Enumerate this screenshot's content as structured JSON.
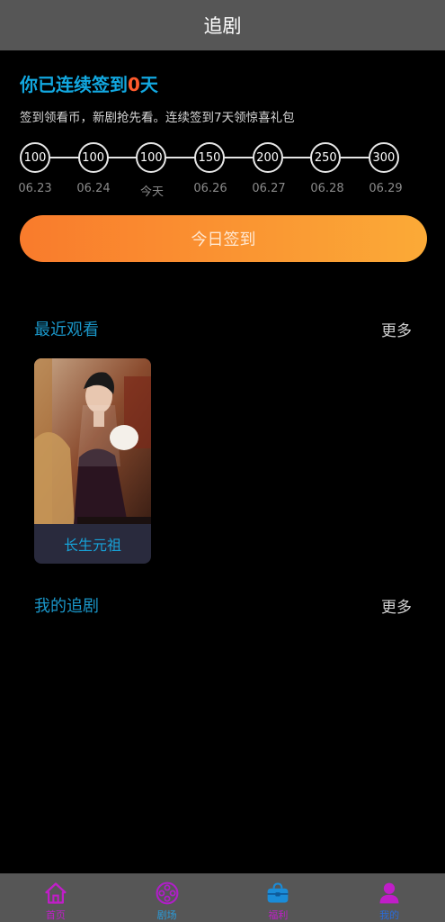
{
  "header": {
    "title": "追剧"
  },
  "checkin": {
    "title_prefix": "你已连续签到",
    "days": "0",
    "title_suffix": "天",
    "subtitle": "签到领看币，新剧抢先看。连续签到7天领惊喜礼包",
    "rewards": [
      "100",
      "100",
      "100",
      "150",
      "200",
      "250",
      "300"
    ],
    "dates": [
      "06.23",
      "06.24",
      "今天",
      "06.26",
      "06.27",
      "06.28",
      "06.29"
    ],
    "button_label": "今日签到"
  },
  "recent": {
    "title": "最近观看",
    "more_label": "更多",
    "items": [
      {
        "title": "长生元祖"
      }
    ]
  },
  "following": {
    "title": "我的追剧",
    "more_label": "更多"
  },
  "bottom_nav": {
    "items": [
      {
        "label": "首页",
        "icon": "home-icon",
        "color": "#c01ec8"
      },
      {
        "label": "剧场",
        "icon": "film-reel-icon",
        "color": "#b01ec8"
      },
      {
        "label": "福利",
        "icon": "gift-bag-icon",
        "color": "#c01ec8"
      },
      {
        "label": "我的",
        "icon": "user-icon",
        "color": "#c01ec8"
      }
    ]
  },
  "colors": {
    "accent_blue": "#12a8e0",
    "accent_orange": "#ff5a2c",
    "button_gradient_start": "#f97b2c",
    "button_gradient_end": "#fbaa37",
    "bar_gray": "#565656"
  }
}
